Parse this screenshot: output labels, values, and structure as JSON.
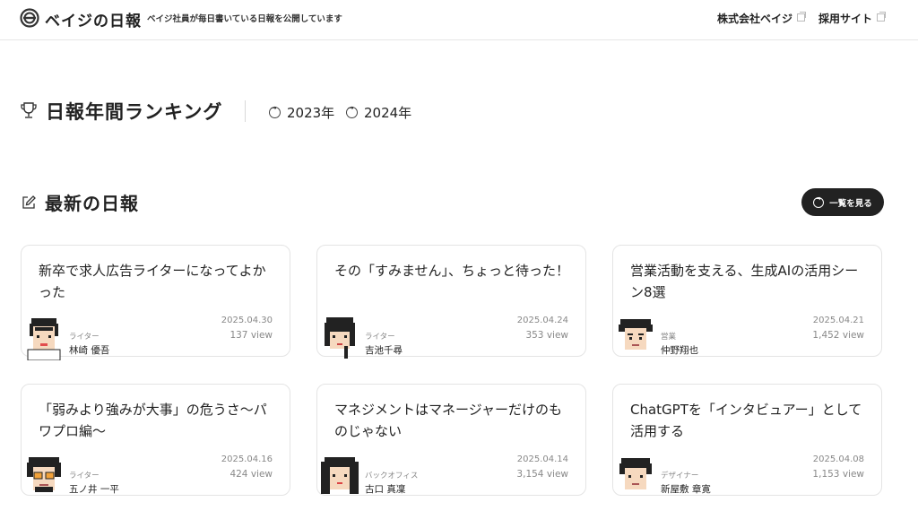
{
  "header": {
    "site_title": "ベイジの日報",
    "tagline": "ベイジ社員が毎日書いている日報を公開しています",
    "links": [
      "株式会社ベイジ",
      "採用サイト"
    ]
  },
  "ranking": {
    "title": "日報年間ランキング",
    "years": [
      "2023年",
      "2024年"
    ]
  },
  "latest": {
    "title": "最新の日報",
    "see_all": "一覧を見る"
  },
  "cards": [
    {
      "title": "新卒で求人広告ライターになってよかった",
      "date": "2025.04.30",
      "views": "137 view",
      "role": "ライター",
      "name": "林崎 優吾"
    },
    {
      "title": "その「すみません」、ちょっと待った！",
      "date": "2025.04.24",
      "views": "353 view",
      "role": "ライター",
      "name": "吉池千尋"
    },
    {
      "title": "営業活動を支える、生成AIの活用シーン8選",
      "date": "2025.04.21",
      "views": "1,452 view",
      "role": "営業",
      "name": "仲野翔也"
    },
    {
      "title": "「弱みより強みが大事」の危うさ〜パワプロ編〜",
      "date": "2025.04.16",
      "views": "424 view",
      "role": "ライター",
      "name": "五ノ井 一平"
    },
    {
      "title": "マネジメントはマネージャーだけのものじゃない",
      "date": "2025.04.14",
      "views": "3,154 view",
      "role": "バックオフィス",
      "name": "古口 真凜"
    },
    {
      "title": "ChatGPTを「インタビュアー」として活用する",
      "date": "2025.04.08",
      "views": "1,153 view",
      "role": "デザイナー",
      "name": "新屋敷 章寛"
    }
  ]
}
